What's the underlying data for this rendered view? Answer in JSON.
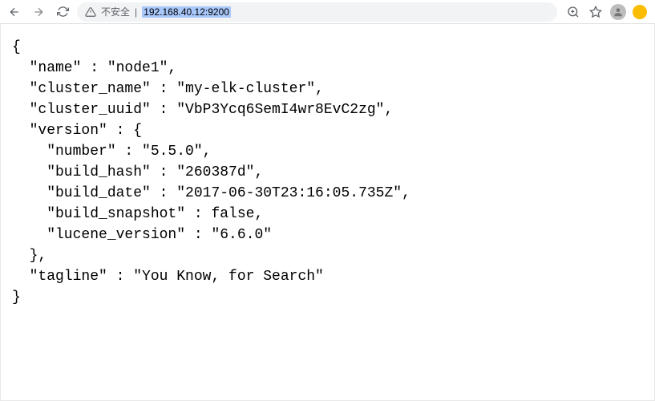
{
  "toolbar": {
    "security_label": "不安全",
    "url": "192.168.40.12:9200"
  },
  "response": {
    "name": "node1",
    "cluster_name": "my-elk-cluster",
    "cluster_uuid": "VbP3Ycq6SemI4wr8EvC2zg",
    "version": {
      "number": "5.5.0",
      "build_hash": "260387d",
      "build_date": "2017-06-30T23:16:05.735Z",
      "build_snapshot": false,
      "lucene_version": "6.6.0"
    },
    "tagline": "You Know, for Search"
  },
  "watermark": ""
}
